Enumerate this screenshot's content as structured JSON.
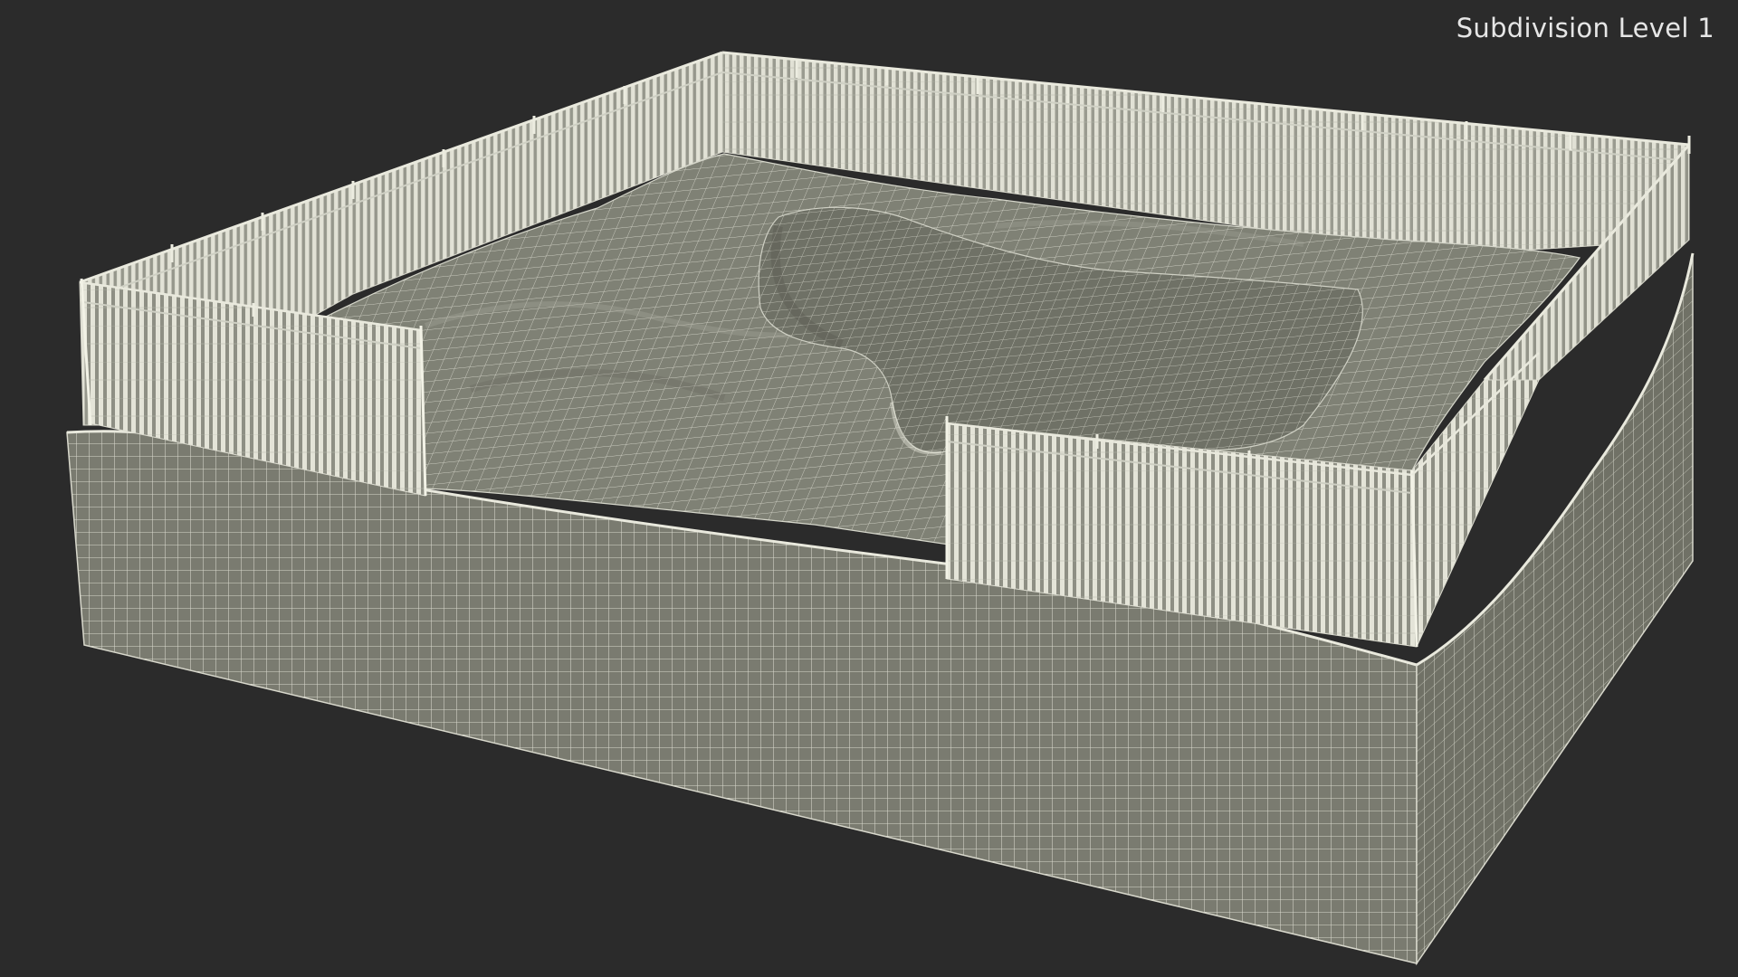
{
  "viewport": {
    "caption": "Subdivision Level 1",
    "background_color": "#2b2b2b"
  },
  "model": {
    "subject": "sandbox-with-fence-wireframe",
    "base_color": "#7c7d72",
    "wire_color": "#e8e8dc",
    "fence_color": "#dcdcd0",
    "sand_color": "#7e8074"
  }
}
